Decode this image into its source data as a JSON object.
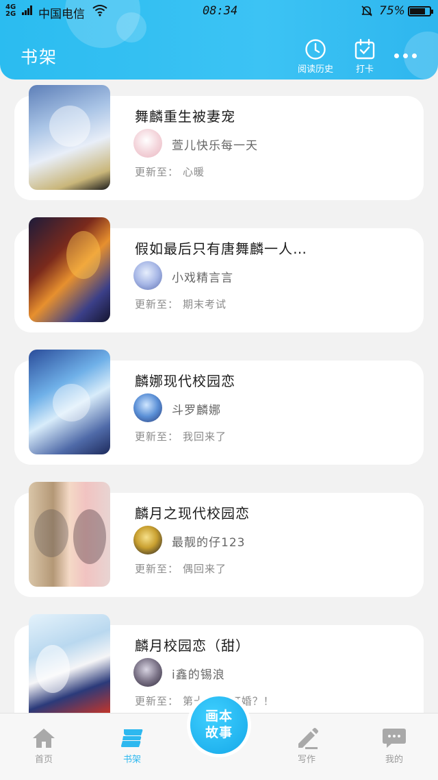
{
  "status_bar": {
    "network": "4G 2G",
    "carrier": "中国电信",
    "time": "08:34",
    "battery": "75%"
  },
  "header": {
    "title": "书架",
    "history_label": "阅读历史",
    "checkin_label": "打卡"
  },
  "books": [
    {
      "title": "舞麟重生被妻宠",
      "author": "萱儿快乐每一天",
      "update_prefix": "更新至：",
      "update_chapter": "心暖"
    },
    {
      "title": "假如最后只有唐舞麟一人…",
      "author": "小戏精言言",
      "update_prefix": "更新至：",
      "update_chapter": "期末考试"
    },
    {
      "title": "麟娜现代校园恋",
      "author": "斗罗麟娜",
      "update_prefix": "更新至：",
      "update_chapter": "我回来了"
    },
    {
      "title": "麟月之现代校园恋",
      "author": "最靓的仔123",
      "update_prefix": "更新至：",
      "update_chapter": "偶回来了"
    },
    {
      "title": "麟月校园恋（甜）",
      "author": "i鑫的锡浪",
      "update_prefix": "更新至：",
      "update_chapter": "第十一章 订婚？！"
    }
  ],
  "bottom_nav": {
    "home": "首页",
    "shelf": "书架",
    "center_line1": "画本",
    "center_line2": "故事",
    "write": "写作",
    "mine": "我的"
  },
  "colors": {
    "accent": "#2db8ef",
    "header_gradient_start": "#2bbcf0",
    "inactive": "#9a9a9a"
  }
}
